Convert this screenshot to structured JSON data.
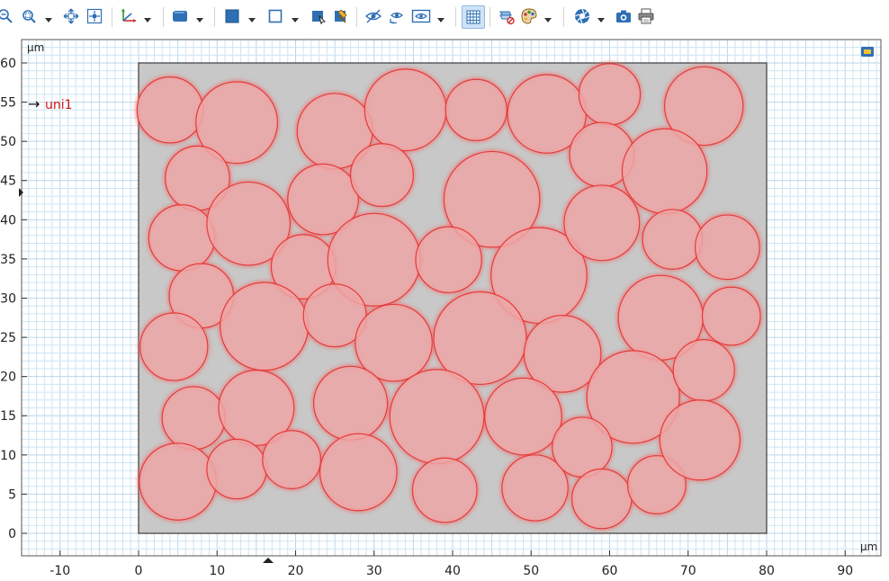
{
  "toolbar": {
    "items": [
      {
        "icon": "zoom-out-icon"
      },
      {
        "icon": "zoom-box-icon"
      },
      {
        "icon": "zoom-extents-icon"
      },
      {
        "icon": "zoom-selected-icon"
      },
      {
        "icon": "axis-orientation-icon"
      },
      {
        "icon": "view-shape-icon"
      },
      {
        "icon": "select-domain-icon"
      },
      {
        "icon": "select-boundary-icon"
      },
      {
        "icon": "select-box-icon"
      },
      {
        "icon": "select-paint-icon"
      },
      {
        "icon": "hide-icon"
      },
      {
        "icon": "reset-hiding-icon"
      },
      {
        "icon": "view-options-icon"
      },
      {
        "icon": "grid-icon",
        "active": true
      },
      {
        "icon": "clear-selection-icon"
      },
      {
        "icon": "color-settings-icon"
      },
      {
        "icon": "lens-icon"
      },
      {
        "icon": "camera-icon"
      },
      {
        "icon": "print-icon"
      }
    ]
  },
  "graphics": {
    "unit_top": "µm",
    "unit_right": "µm",
    "annotation": "uni1",
    "x_ticks": [
      "-10",
      "0",
      "10",
      "20",
      "30",
      "40",
      "50",
      "60",
      "70",
      "80",
      "90"
    ],
    "y_ticks": [
      "0",
      "5",
      "10",
      "15",
      "20",
      "25",
      "30",
      "35",
      "40",
      "45",
      "50",
      "55",
      "60"
    ],
    "rectangle": {
      "x": [
        0,
        80
      ],
      "y": [
        0,
        60
      ]
    },
    "colors": {
      "domain_fill": "#c8c8c8",
      "circle_fill": "#eda6a6",
      "circle_stroke": "#e43b3b",
      "grid": "#cfe4f2",
      "grid_major": "#b9d6ea"
    },
    "circles": [
      [
        4,
        54,
        4.2
      ],
      [
        12.5,
        52.4,
        5.2
      ],
      [
        25,
        51.3,
        4.8
      ],
      [
        34,
        54,
        5.2
      ],
      [
        43,
        54,
        3.9
      ],
      [
        52,
        53.5,
        5
      ],
      [
        60,
        56,
        3.9
      ],
      [
        72,
        54.5,
        5
      ],
      [
        7.5,
        45.3,
        4.1
      ],
      [
        23.5,
        42.6,
        4.5
      ],
      [
        31,
        45.7,
        4
      ],
      [
        45,
        42.6,
        6.1
      ],
      [
        59,
        48.3,
        4.1
      ],
      [
        67,
        46.2,
        5.4
      ],
      [
        5.5,
        37.7,
        4.2
      ],
      [
        14,
        39.5,
        5.3
      ],
      [
        21,
        34,
        4.1
      ],
      [
        30,
        34.9,
        5.9
      ],
      [
        39.5,
        34.9,
        4.2
      ],
      [
        51,
        32.9,
        6.1
      ],
      [
        59,
        39.6,
        4.8
      ],
      [
        68,
        37.5,
        3.8
      ],
      [
        75,
        36.5,
        4.1
      ],
      [
        8,
        30.3,
        4.1
      ],
      [
        16,
        26.4,
        5.6
      ],
      [
        25,
        27.8,
        4
      ],
      [
        32.5,
        24.3,
        4.9
      ],
      [
        43.5,
        24.9,
        5.9
      ],
      [
        54,
        22.9,
        4.9
      ],
      [
        66.5,
        27.5,
        5.4
      ],
      [
        75.5,
        27.7,
        3.7
      ],
      [
        4.5,
        23.8,
        4.3
      ],
      [
        7,
        14.7,
        4
      ],
      [
        15,
        16,
        4.8
      ],
      [
        27,
        16.6,
        4.7
      ],
      [
        38,
        14.9,
        6
      ],
      [
        49,
        14.9,
        4.9
      ],
      [
        63,
        17.4,
        5.9
      ],
      [
        72,
        20.8,
        3.9
      ],
      [
        5,
        6.6,
        4.9
      ],
      [
        12.5,
        8.2,
        3.8
      ],
      [
        19.5,
        9.4,
        3.7
      ],
      [
        28,
        7.8,
        4.9
      ],
      [
        39,
        5.5,
        4.1
      ],
      [
        50.5,
        5.8,
        4.2
      ],
      [
        56.5,
        11,
        3.8
      ],
      [
        59,
        4.4,
        3.8
      ],
      [
        66,
        6.2,
        3.7
      ],
      [
        71.5,
        11.9,
        5.1
      ]
    ]
  }
}
